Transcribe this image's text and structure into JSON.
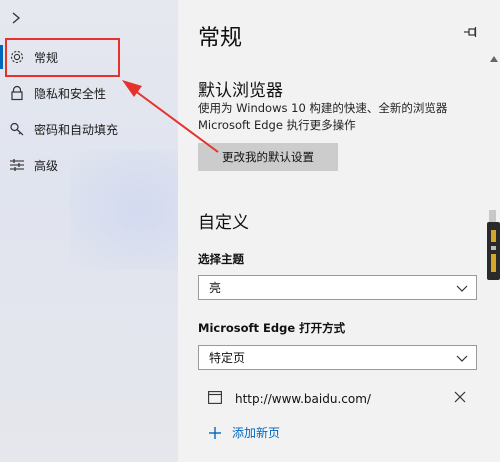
{
  "sidebar": {
    "items": [
      {
        "label": "常规",
        "icon": "gear-icon"
      },
      {
        "label": "隐私和安全性",
        "icon": "lock-icon"
      },
      {
        "label": "密码和自动填充",
        "icon": "key-icon"
      },
      {
        "label": "高级",
        "icon": "sliders-icon"
      }
    ]
  },
  "main": {
    "title": "常规",
    "default_browser": {
      "heading": "默认浏览器",
      "description": "使用为 Windows 10 构建的快速、全新的浏览器 Microsoft Edge 执行更多操作",
      "button": "更改我的默认设置"
    },
    "customize": {
      "heading": "自定义",
      "theme_label": "选择主题",
      "theme_value": "亮",
      "open_label": "Microsoft Edge 打开方式",
      "open_value": "特定页",
      "pages": [
        {
          "url": "http://www.baidu.com/"
        }
      ],
      "add_page": "添加新页"
    }
  },
  "colors": {
    "accent": "#0067c0",
    "annotation": "#e5322d"
  }
}
